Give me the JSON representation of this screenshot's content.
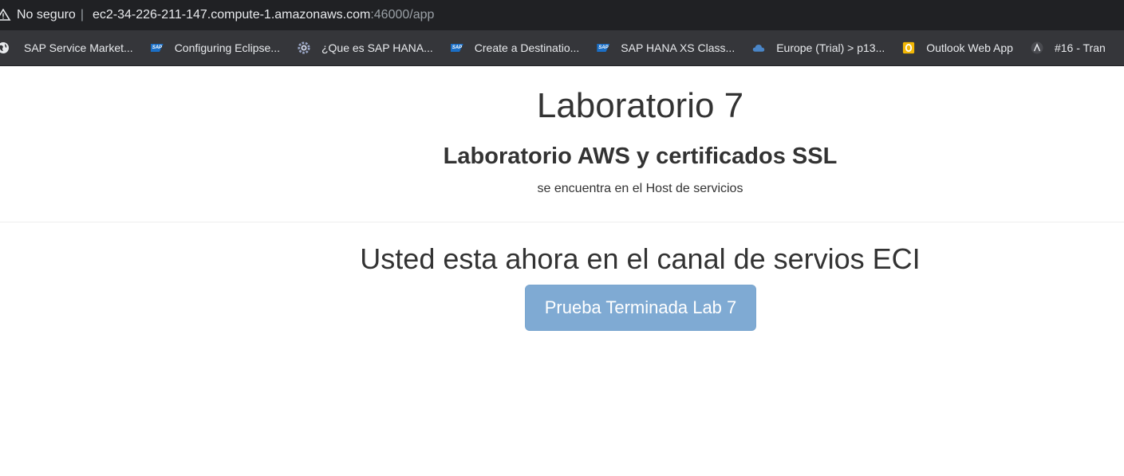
{
  "browser": {
    "security_label": "No seguro",
    "separator": "|",
    "url_host": "ec2-34-226-211-147.compute-1.amazonaws.com",
    "url_rest": ":46000/app"
  },
  "bookmarks": [
    {
      "label": "SAP Service Market...",
      "icon": "globe-icon"
    },
    {
      "label": "Configuring Eclipse...",
      "icon": "sap-logo-icon"
    },
    {
      "label": "¿Que es SAP HANA...",
      "icon": "gear-icon"
    },
    {
      "label": "Create a Destinatio...",
      "icon": "sap-logo-icon"
    },
    {
      "label": "SAP HANA XS Class...",
      "icon": "sap-logo-icon"
    },
    {
      "label": "Europe (Trial) > p13...",
      "icon": "cloud-icon"
    },
    {
      "label": "Outlook Web App",
      "icon": "outlook-icon"
    },
    {
      "label": "#16 - Tran",
      "icon": "lambda-icon"
    }
  ],
  "page": {
    "title": "Laboratorio 7",
    "subtitle": "Laboratorio AWS y certificados SSL",
    "host_text": "se encuentra en el Host de servicios",
    "channel_text": "Usted esta ahora en el canal de servios ECI",
    "button_label": "Prueba Terminada Lab 7"
  },
  "colors": {
    "button": "#7faad3",
    "address_bar": "#202124",
    "bookmark_bar": "#35363a"
  }
}
